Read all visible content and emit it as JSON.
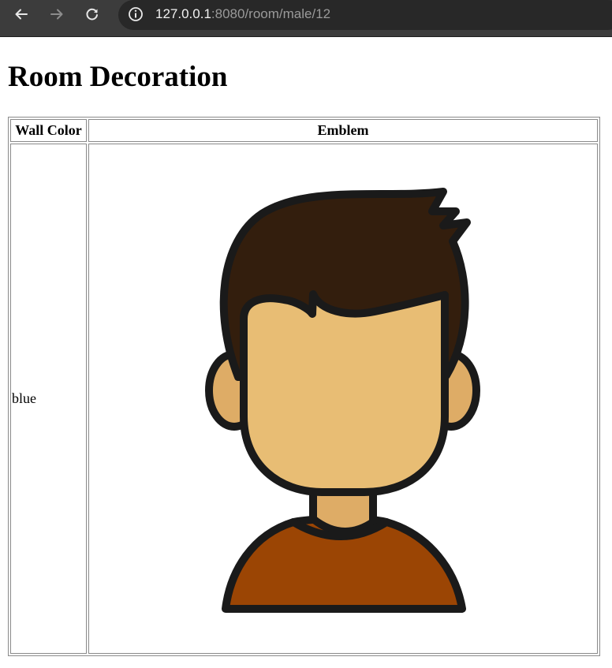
{
  "browser": {
    "url_host": "127.0.0.1",
    "url_path": ":8080/room/male/12",
    "icons": {
      "back": "back-arrow-icon",
      "forward": "forward-arrow-icon",
      "reload": "reload-icon",
      "site_info": "info-icon"
    },
    "colors": {
      "toolbar": "#3c3c3c",
      "address_bar": "#282828"
    }
  },
  "page": {
    "title": "Room Decoration"
  },
  "table": {
    "headers": [
      "Wall Color",
      "Emblem"
    ],
    "rows": [
      {
        "wall_color": "blue",
        "emblem": "male-avatar-emblem"
      }
    ]
  },
  "emblem": {
    "icon": "male-avatar-icon",
    "colors": {
      "hair": "#331e0d",
      "skin": "#e8bd74",
      "ear_neck": "#deac66",
      "shirt": "#9b4504",
      "outline": "#1a1a1a"
    }
  }
}
